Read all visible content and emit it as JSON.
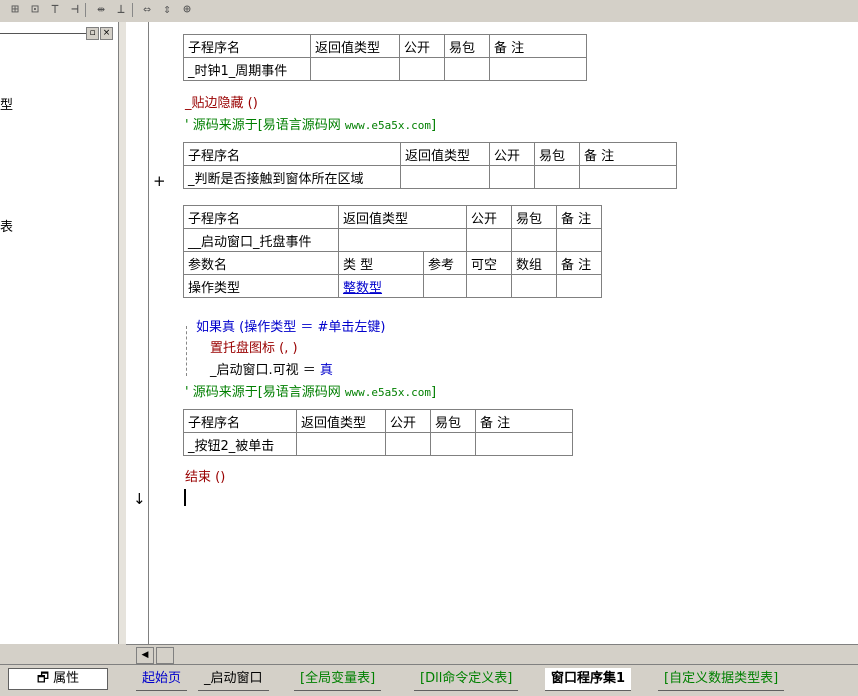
{
  "toolbar": {
    "icons": [
      "align-left-icon",
      "align-center-icon",
      "align-top-icon",
      "align-right-icon",
      "same-width-icon",
      "same-height-icon",
      "stretch-width-icon",
      "stretch-height-icon",
      "center-icon"
    ]
  },
  "left_panel": {
    "items": [
      "型",
      "表"
    ],
    "minimize": "▫",
    "close": "×"
  },
  "tables": [
    {
      "headers": [
        "子程序名",
        "返回值类型",
        "公开",
        "易包",
        "备 注"
      ],
      "row": [
        "_时钟1_周期事件",
        "",
        "",
        "",
        ""
      ]
    },
    {
      "headers": [
        "子程序名",
        "返回值类型",
        "公开",
        "易包",
        "备 注"
      ],
      "row": [
        "_判断是否接触到窗体所在区域",
        "",
        "",
        "",
        ""
      ]
    },
    {
      "headers": [
        "子程序名",
        "返回值类型",
        "公开",
        "易包",
        "备 注"
      ],
      "row": [
        "__启动窗口_托盘事件",
        "",
        "",
        "",
        ""
      ],
      "param_headers": [
        "参数名",
        "类 型",
        "参考",
        "可空",
        "数组",
        "备 注"
      ],
      "param_row": [
        "操作类型",
        "整数型",
        "",
        "",
        "",
        ""
      ]
    },
    {
      "headers": [
        "子程序名",
        "返回值类型",
        "公开",
        "易包",
        "备 注"
      ],
      "row": [
        "_按钮2_被单击",
        "",
        "",
        "",
        ""
      ]
    }
  ],
  "code": {
    "line1": "_贴边隐藏 ()",
    "comment1_prefix": "' 源码来源于[易语言源码网 ",
    "comment_url": "www.e5a5x.com",
    "comment_suffix": "]",
    "if_line": "如果真 (操作类型 ＝ #单击左键)",
    "set_tray": "置托盘图标 (, )",
    "visible_line_a": "_启动窗口.可视 ＝ ",
    "visible_line_b": "真",
    "end_line": "结束 ()"
  },
  "gutter": {
    "plus": "+",
    "arrow": "↓"
  },
  "tabs": {
    "props": "属性",
    "items": [
      "起始页",
      "_启动窗口",
      "[全局变量表]",
      "[Dll命令定义表]",
      "窗口程序集1",
      "[自定义数据类型表]"
    ],
    "active_index": 4
  }
}
